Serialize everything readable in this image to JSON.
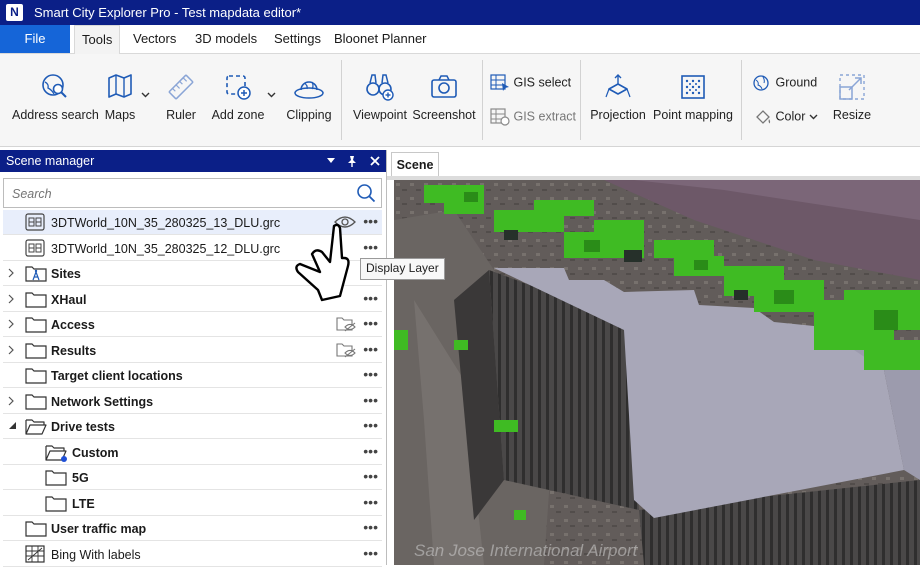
{
  "app": {
    "logo_text": "N",
    "title": "Smart City Explorer Pro - Test mapdata editor*"
  },
  "menu": {
    "file": "File",
    "tabs": [
      "Tools",
      "Vectors",
      "3D models",
      "Settings",
      "Bloonet Planner"
    ],
    "active_tab": "Tools"
  },
  "ribbon": {
    "address_search": "Address search",
    "maps": "Maps",
    "ruler": "Ruler",
    "add_zone": "Add zone",
    "clipping": "Clipping",
    "viewpoint": "Viewpoint",
    "screenshot": "Screenshot",
    "gis_select": "GIS select",
    "gis_extract": "GIS extract",
    "projection": "Projection",
    "point_mapping": "Point mapping",
    "ground": "Ground",
    "color": "Color",
    "resize": "Resize"
  },
  "scene_manager": {
    "title": "Scene manager",
    "search_placeholder": "Search",
    "tooltip": "Display Layer",
    "rows": [
      {
        "label": "3DTWorld_10N_35_280325_13_DLU.grc",
        "icon": "grid-layer-icon"
      },
      {
        "label": "3DTWorld_10N_35_280325_12_DLU.grc",
        "icon": "grid-layer-icon"
      },
      {
        "label": "Sites",
        "icon": "tower-folder-icon"
      },
      {
        "label": "XHaul",
        "icon": "folder-icon"
      },
      {
        "label": "Access",
        "icon": "folder-icon"
      },
      {
        "label": "Results",
        "icon": "folder-icon"
      },
      {
        "label": "Target client locations",
        "icon": "folder-icon"
      },
      {
        "label": "Network Settings",
        "icon": "folder-icon"
      },
      {
        "label": "Drive tests",
        "icon": "folder-icon"
      },
      {
        "label": "Custom",
        "icon": "folder-icon"
      },
      {
        "label": "5G",
        "icon": "folder-icon"
      },
      {
        "label": "LTE",
        "icon": "folder-icon"
      },
      {
        "label": "User traffic map",
        "icon": "folder-icon"
      },
      {
        "label": "Bing With labels",
        "icon": "map-tiles-icon"
      }
    ]
  },
  "scene": {
    "tab_label": "Scene",
    "map_label": "San Jose International Airport",
    "colors": {
      "building_roof": "#a8a7b8",
      "vegetation": "#3fbb23",
      "ground": "#5e5856"
    }
  },
  "colors": {
    "title_bar": "#0b1f87",
    "file_button": "#1565d8",
    "icon_blue": "#1f5bb6"
  }
}
